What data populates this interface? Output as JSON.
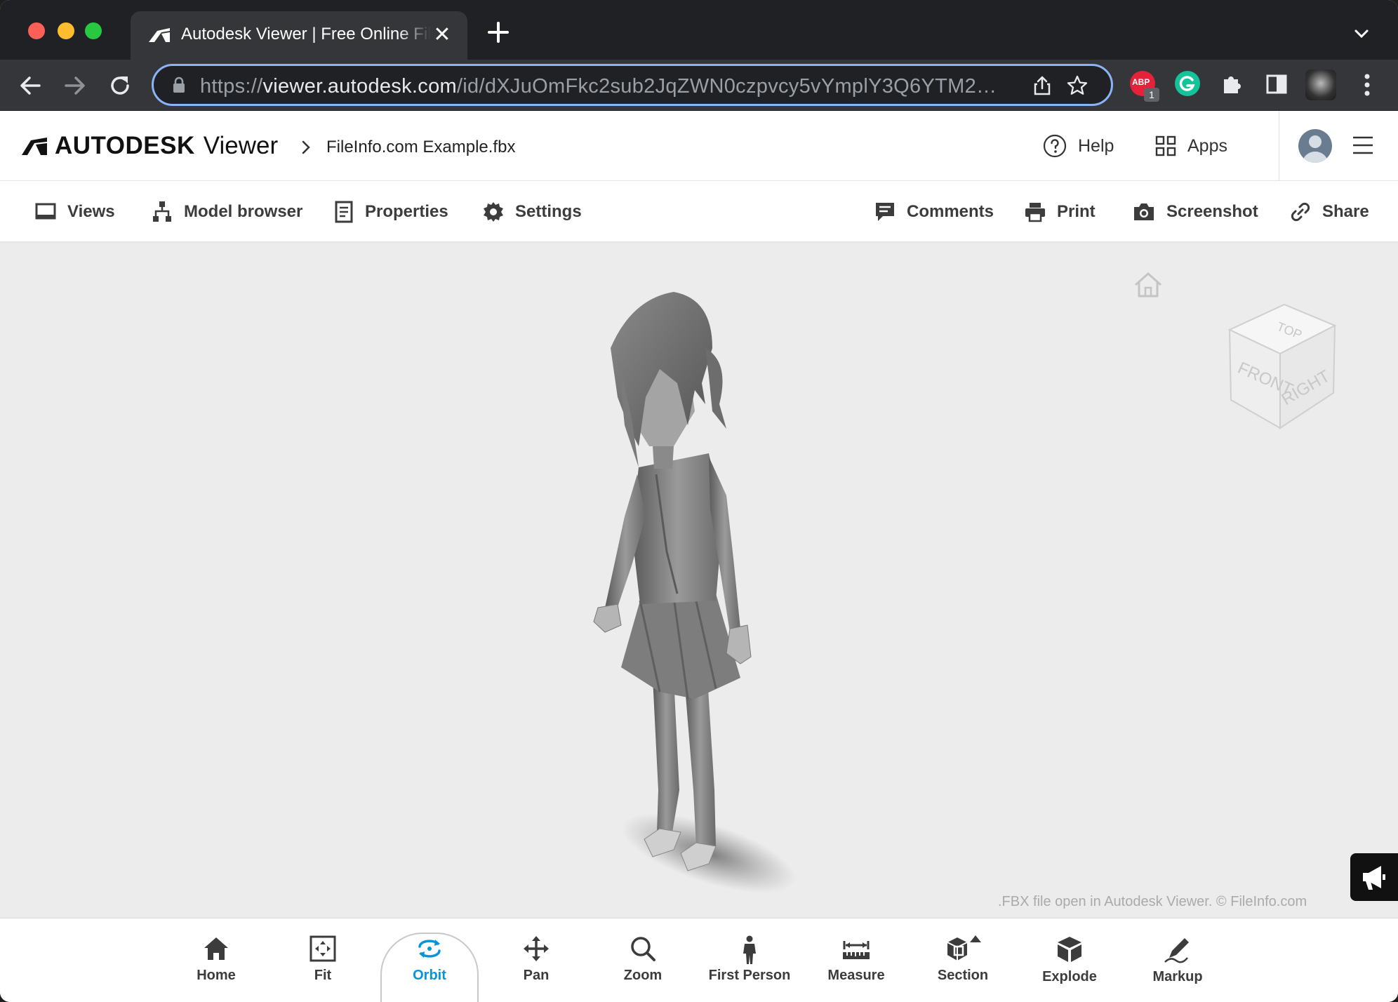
{
  "browser": {
    "tab_title": "Autodesk Viewer | Free Online File Viewer",
    "tab_close": "✕",
    "url_prefix": "https://",
    "url_host": "viewer.autodesk.com",
    "url_path": "/id/dXJuOmFkc2sub2JqZWN0czpvcy5vYmplY3Q6YTM2…",
    "ext_badge_count": "1",
    "ext_abp_label": "ABP"
  },
  "header": {
    "brand_name": "AUTODESK",
    "brand_product": "Viewer",
    "file_name": "FileInfo.com Example.fbx",
    "help_label": "Help",
    "apps_label": "Apps"
  },
  "topbar": {
    "views": "Views",
    "model_browser": "Model browser",
    "properties": "Properties",
    "settings": "Settings",
    "comments": "Comments",
    "print": "Print",
    "screenshot": "Screenshot",
    "share": "Share"
  },
  "viewcube": {
    "top": "TOP",
    "front": "FRONT",
    "right": "RIGHT"
  },
  "viewport": {
    "caption": ".FBX file open in Autodesk Viewer. © FileInfo.com"
  },
  "bottombar": {
    "active_tool": "Orbit",
    "active_color": "#0696d7",
    "tools": [
      "Home",
      "Fit",
      "Orbit",
      "Pan",
      "Zoom",
      "First Person",
      "Measure",
      "Section",
      "Explode",
      "Markup"
    ]
  }
}
